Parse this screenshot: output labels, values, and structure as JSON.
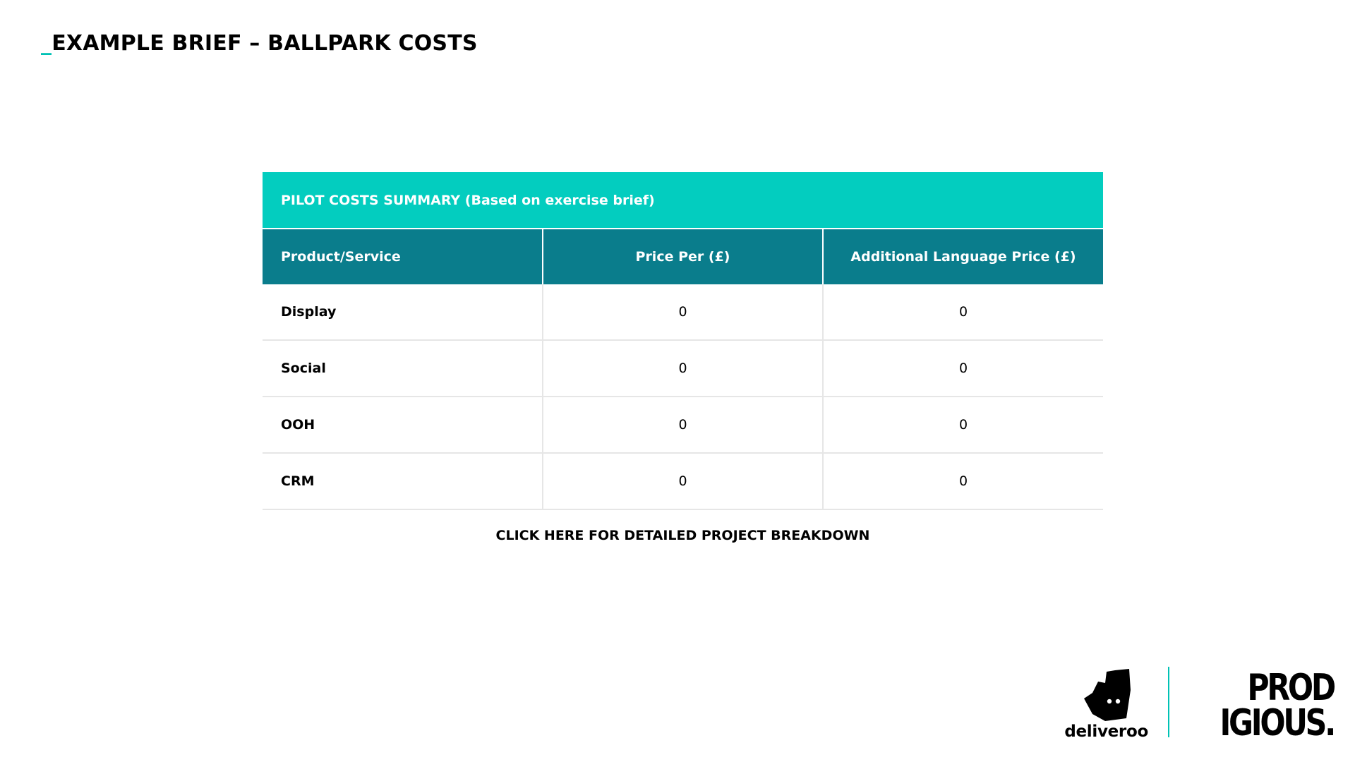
{
  "slide": {
    "title_prefix": "_",
    "title": "EXAMPLE BRIEF – BALLPARK COSTS"
  },
  "table": {
    "banner": "PILOT COSTS SUMMARY (Based on exercise brief)",
    "headers": [
      "Product/Service",
      "Price Per (£)",
      "Additional Language Price (£)"
    ],
    "rows": [
      [
        "Display",
        "0",
        "0"
      ],
      [
        "Social",
        "0",
        "0"
      ],
      [
        "OOH",
        "0",
        "0"
      ],
      [
        "CRM",
        "0",
        "0"
      ]
    ]
  },
  "cta": {
    "label": "CLICK HERE FOR DETAILED PROJECT BREAKDOWN"
  },
  "logos": {
    "deliveroo": "deliveroo",
    "prodigious_line1": "PROD",
    "prodigious_line2": "IGIOUS.",
    "deliveroo_icon": "deliveroo-kangaroo-icon",
    "accent_color": "#00c2b5",
    "banner_color": "#03cdbf",
    "header_color": "#0a7d8c"
  }
}
